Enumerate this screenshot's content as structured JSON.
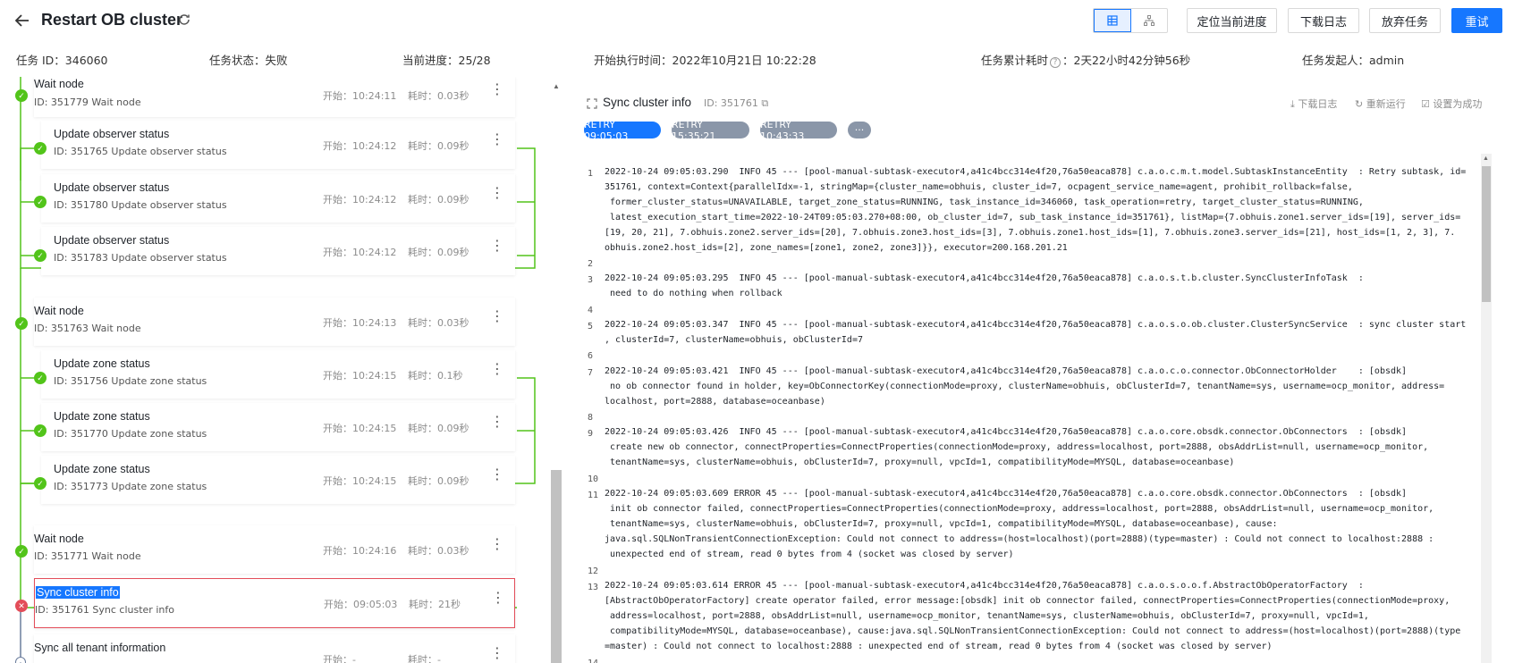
{
  "header": {
    "title": "Restart OB cluster",
    "buttons": {
      "locate": "定位当前进度",
      "download_log": "下载日志",
      "abandon": "放弃任务",
      "retry": "重试"
    }
  },
  "info": {
    "task_id": "任务 ID：346060",
    "status": "任务状态：失败",
    "progress": "当前进度：25/28",
    "start_time": "开始执行时间：2022年10月21日 10:22:28",
    "elapsed_label": "任务累计耗时",
    "elapsed_value": "：2天22小时42分钟56秒",
    "initiator": "任务发起人：admin"
  },
  "nodes": [
    {
      "name": "Wait node",
      "id": "ID: 351779   Wait node",
      "start": "开始：10:24:11",
      "dur": "耗时：0.03秒"
    },
    {
      "name": "Update observer status",
      "id": "ID: 351765   Update observer status",
      "start": "开始：10:24:12",
      "dur": "耗时：0.09秒"
    },
    {
      "name": "Update observer status",
      "id": "ID: 351780   Update observer status",
      "start": "开始：10:24:12",
      "dur": "耗时：0.09秒"
    },
    {
      "name": "Update observer status",
      "id": "ID: 351783   Update observer status",
      "start": "开始：10:24:12",
      "dur": "耗时：0.09秒"
    },
    {
      "name": "Wait node",
      "id": "ID: 351763   Wait node",
      "start": "开始：10:24:13",
      "dur": "耗时：0.03秒"
    },
    {
      "name": "Update zone status",
      "id": "ID: 351756   Update zone status",
      "start": "开始：10:24:15",
      "dur": "耗时：0.1秒"
    },
    {
      "name": "Update zone status",
      "id": "ID: 351770   Update zone status",
      "start": "开始：10:24:15",
      "dur": "耗时：0.09秒"
    },
    {
      "name": "Update zone status",
      "id": "ID: 351773   Update zone status",
      "start": "开始：10:24:15",
      "dur": "耗时：0.09秒"
    },
    {
      "name": "Wait node",
      "id": "ID: 351771   Wait node",
      "start": "开始：10:24:16",
      "dur": "耗时：0.03秒"
    },
    {
      "name": "Sync cluster info",
      "id": "ID: 351761   Sync cluster info",
      "start": "开始：09:05:03",
      "dur": "耗时：21秒"
    },
    {
      "name": "Sync all tenant information",
      "id": "",
      "start": "开始：-",
      "dur": "耗时：-"
    }
  ],
  "detail": {
    "title": "Sync cluster info",
    "id": "ID: 351761",
    "actions": {
      "download": "下载日志",
      "rerun": "重新运行",
      "set_success": "设置为成功"
    },
    "retries": [
      "RETRY 09:05:03",
      "RETRY 15:35:21",
      "RETRY 10:43:33",
      "···"
    ]
  },
  "log_numbers": [
    "1",
    "2",
    "3",
    "4",
    "5",
    "6",
    "7",
    "8",
    "9",
    "10",
    "11",
    "12",
    "13",
    "14"
  ],
  "log_lines": [
    "2022-10-24 09:05:03.290  INFO 45 --- [pool-manual-subtask-executor4,a41c4bcc314e4f20,76a50eaca878] c.a.o.c.m.t.model.SubtaskInstanceEntity  : Retry subtask, id=",
    "351761, context=Context{parallelIdx=-1, stringMap={cluster_name=obhuis, cluster_id=7, ocpagent_service_name=agent, prohibit_rollback=false,",
    " former_cluster_status=UNAVAILABLE, target_zone_status=RUNNING, task_instance_id=346060, task_operation=retry, target_cluster_status=RUNNING,",
    " latest_execution_start_time=2022-10-24T09:05:03.270+08:00, ob_cluster_id=7, sub_task_instance_id=351761}, listMap={7.obhuis.zone1.server_ids=[19], server_ids=",
    "[19, 20, 21], 7.obhuis.zone2.server_ids=[20], 7.obhuis.zone3.host_ids=[3], 7.obhuis.zone1.host_ids=[1], 7.obhuis.zone3.server_ids=[21], host_ids=[1, 2, 3], 7.",
    "obhuis.zone2.host_ids=[2], zone_names=[zone1, zone2, zone3]}}, executor=200.168.201.21",
    "2022-10-24 09:05:03.295  INFO 45 --- [pool-manual-subtask-executor4,a41c4bcc314e4f20,76a50eaca878] c.a.o.s.t.b.cluster.SyncClusterInfoTask  :",
    " need to do nothing when rollback",
    "2022-10-24 09:05:03.347  INFO 45 --- [pool-manual-subtask-executor4,a41c4bcc314e4f20,76a50eaca878] c.a.o.s.o.ob.cluster.ClusterSyncService  : sync cluster start",
    ", clusterId=7, clusterName=obhuis, obClusterId=7",
    "2022-10-24 09:05:03.421  INFO 45 --- [pool-manual-subtask-executor4,a41c4bcc314e4f20,76a50eaca878] c.a.o.c.o.connector.ObConnectorHolder    : [obsdk]",
    " no ob connector found in holder, key=ObConnectorKey(connectionMode=proxy, clusterName=obhuis, obClusterId=7, tenantName=sys, username=ocp_monitor, address=",
    "localhost, port=2888, database=oceanbase)",
    "2022-10-24 09:05:03.426  INFO 45 --- [pool-manual-subtask-executor4,a41c4bcc314e4f20,76a50eaca878] c.a.o.core.obsdk.connector.ObConnectors  : [obsdk]",
    " create new ob connector, connectProperties=ConnectProperties(connectionMode=proxy, address=localhost, port=2888, obsAddrList=null, username=ocp_monitor,",
    " tenantName=sys, clusterName=obhuis, obClusterId=7, proxy=null, vpcId=1, compatibilityMode=MYSQL, database=oceanbase)",
    "2022-10-24 09:05:03.609 ERROR 45 --- [pool-manual-subtask-executor4,a41c4bcc314e4f20,76a50eaca878] c.a.o.core.obsdk.connector.ObConnectors  : [obsdk]",
    " init ob connector failed, connectProperties=ConnectProperties(connectionMode=proxy, address=localhost, port=2888, obsAddrList=null, username=ocp_monitor,",
    " tenantName=sys, clusterName=obhuis, obClusterId=7, proxy=null, vpcId=1, compatibilityMode=MYSQL, database=oceanbase), cause:",
    "java.sql.SQLNonTransientConnectionException: Could not connect to address=(host=localhost)(port=2888)(type=master) : Could not connect to localhost:2888 :",
    " unexpected end of stream, read 0 bytes from 4 (socket was closed by server)",
    "2022-10-24 09:05:03.614 ERROR 45 --- [pool-manual-subtask-executor4,a41c4bcc314e4f20,76a50eaca878] c.a.o.s.o.o.f.AbstractObOperatorFactory  :",
    "[AbstractObOperatorFactory] create operator failed, error message:[obsdk] init ob connector failed, connectProperties=ConnectProperties(connectionMode=proxy,",
    " address=localhost, port=2888, obsAddrList=null, username=ocp_monitor, tenantName=sys, clusterName=obhuis, obClusterId=7, proxy=null, vpcId=1,",
    " compatibilityMode=MYSQL, database=oceanbase), cause:java.sql.SQLNonTransientConnectionException: Could not connect to address=(host=localhost)(port=2888)(type",
    "=master) : Could not connect to localhost:2888 : unexpected end of stream, read 0 bytes from 4 (socket was closed by server)"
  ],
  "colors": {
    "primary": "#1677ff",
    "success": "#52c41a",
    "error": "#e34d59",
    "retry_chip": "#8a96a8"
  }
}
